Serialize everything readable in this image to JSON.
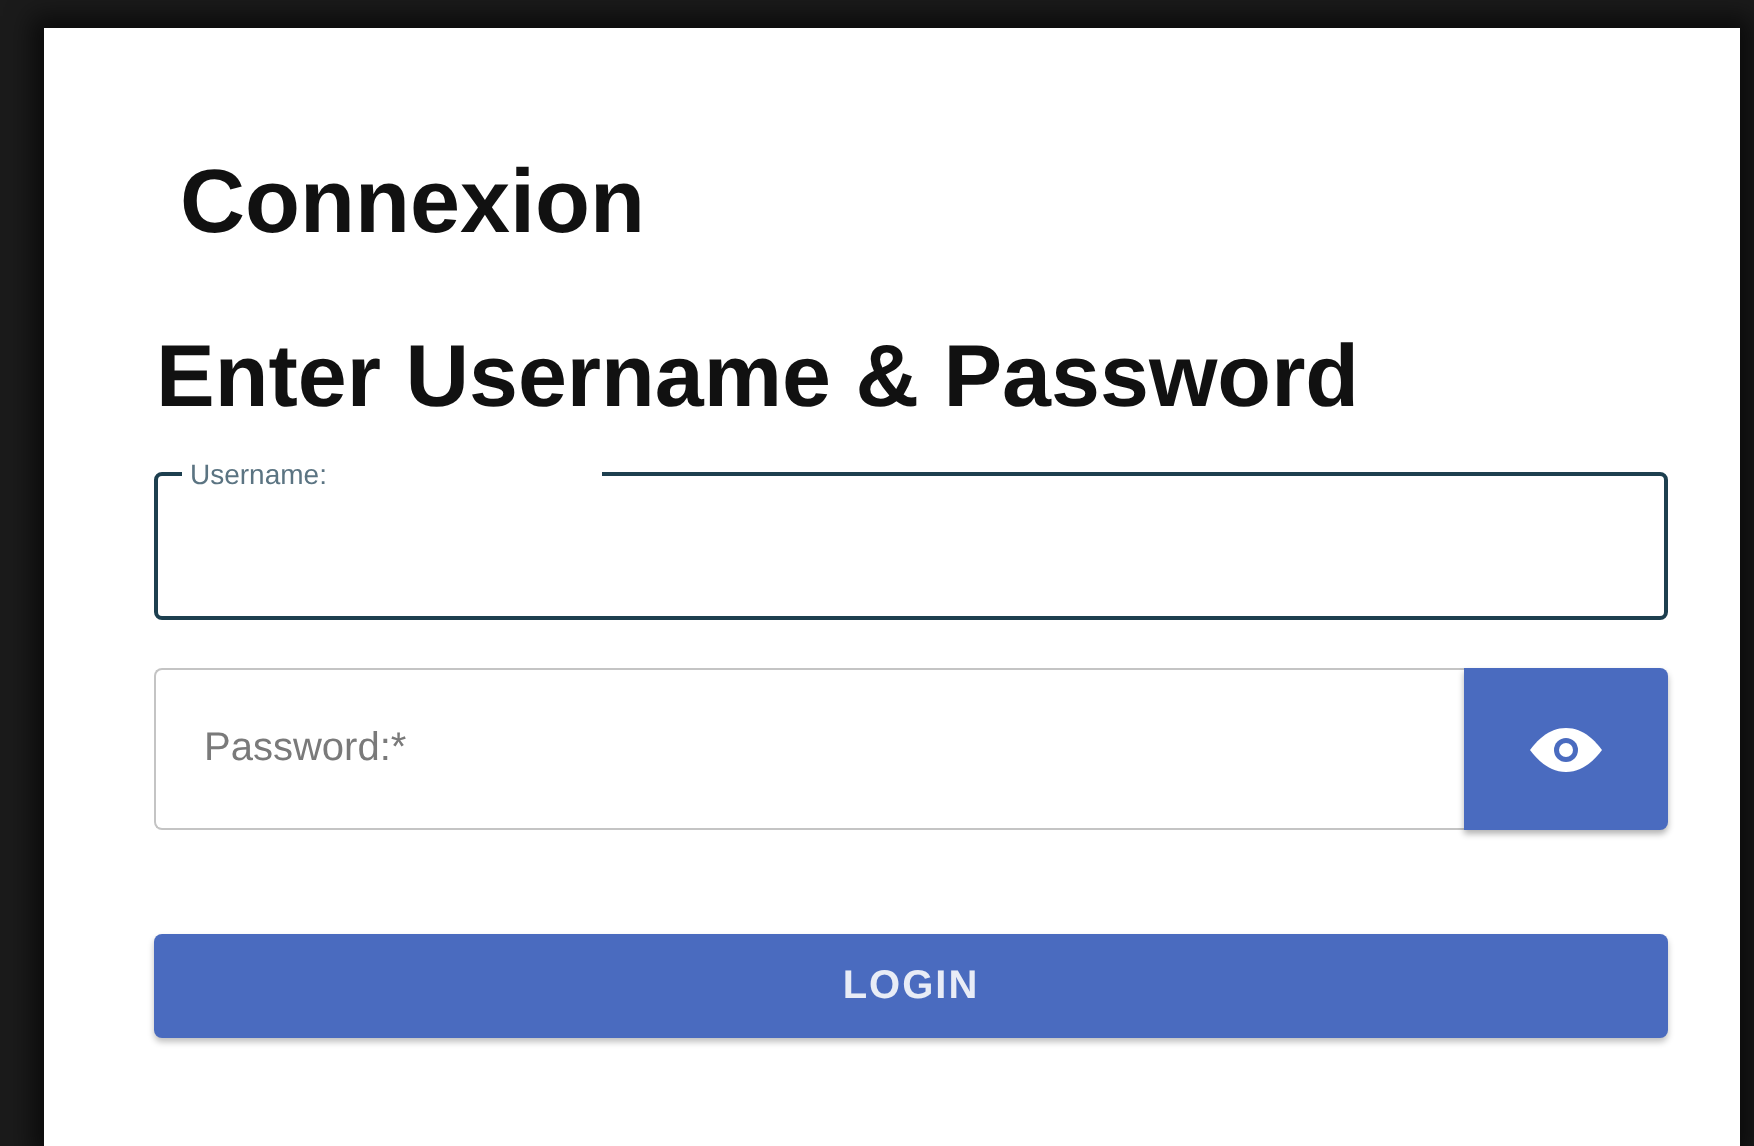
{
  "title": "Connexion",
  "heading": "Enter Username & Password",
  "fields": [
    {
      "kind": "text",
      "label": "Username:",
      "focused": true
    },
    {
      "kind": "password",
      "placeholder": "Password:*",
      "focused": false
    }
  ],
  "login_button": "LOGIN"
}
